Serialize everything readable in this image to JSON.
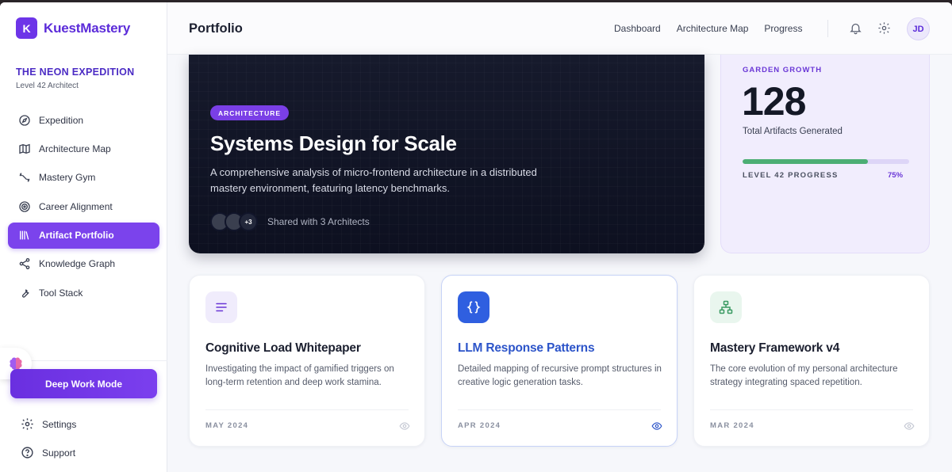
{
  "app": {
    "logo_letter": "K",
    "name": "KuestMastery"
  },
  "expedition": {
    "title": "THE NEON EXPEDITION",
    "subtitle": "Level 42 Architect"
  },
  "sidebar": {
    "items": [
      {
        "label": "Expedition",
        "icon": "compass-icon"
      },
      {
        "label": "Architecture Map",
        "icon": "map-icon"
      },
      {
        "label": "Mastery Gym",
        "icon": "dumbbell-icon"
      },
      {
        "label": "Career Alignment",
        "icon": "target-icon"
      },
      {
        "label": "Artifact Portfolio",
        "icon": "library-icon",
        "active": true
      },
      {
        "label": "Knowledge Graph",
        "icon": "share-nodes-icon"
      },
      {
        "label": "Tool Stack",
        "icon": "wrench-icon"
      }
    ],
    "deep_work_label": "Deep Work Mode",
    "settings_label": "Settings",
    "support_label": "Support"
  },
  "header": {
    "title": "Portfolio",
    "nav": [
      "Dashboard",
      "Architecture Map",
      "Progress"
    ],
    "avatar_initials": "JD"
  },
  "hero": {
    "tag": "ARCHITECTURE",
    "title": "Systems Design for Scale",
    "description": "A comprehensive analysis of micro-frontend architecture in a distributed mastery environment, featuring latency benchmarks.",
    "more_count": "+3",
    "share_text": "Shared with 3 Architects"
  },
  "growth": {
    "label": "GARDEN GROWTH",
    "count": "128",
    "count_label": "Total Artifacts Generated",
    "level_label": "LEVEL 42 PROGRESS",
    "progress_text": "75%",
    "progress_fraction": 0.75
  },
  "artifacts": [
    {
      "title": "Cognitive Load Whitepaper",
      "description": "Investigating the impact of gamified triggers on long-term retention and deep work stamina.",
      "date": "MAY 2024",
      "icon": "lines-icon"
    },
    {
      "title": "LLM Response Patterns",
      "description": "Detailed mapping of recursive prompt structures in creative logic generation tasks.",
      "date": "APR 2024",
      "icon": "braces-icon",
      "highlighted": true
    },
    {
      "title": "Mastery Framework v4",
      "description": "The core evolution of my personal architecture strategy integrating spaced repetition.",
      "date": "MAR 2024",
      "icon": "hierarchy-icon"
    }
  ],
  "colors": {
    "accent": "#7b43ec",
    "brand": "#5b2bd9",
    "progress": "#4cae74",
    "link_blue": "#2c54c9"
  }
}
